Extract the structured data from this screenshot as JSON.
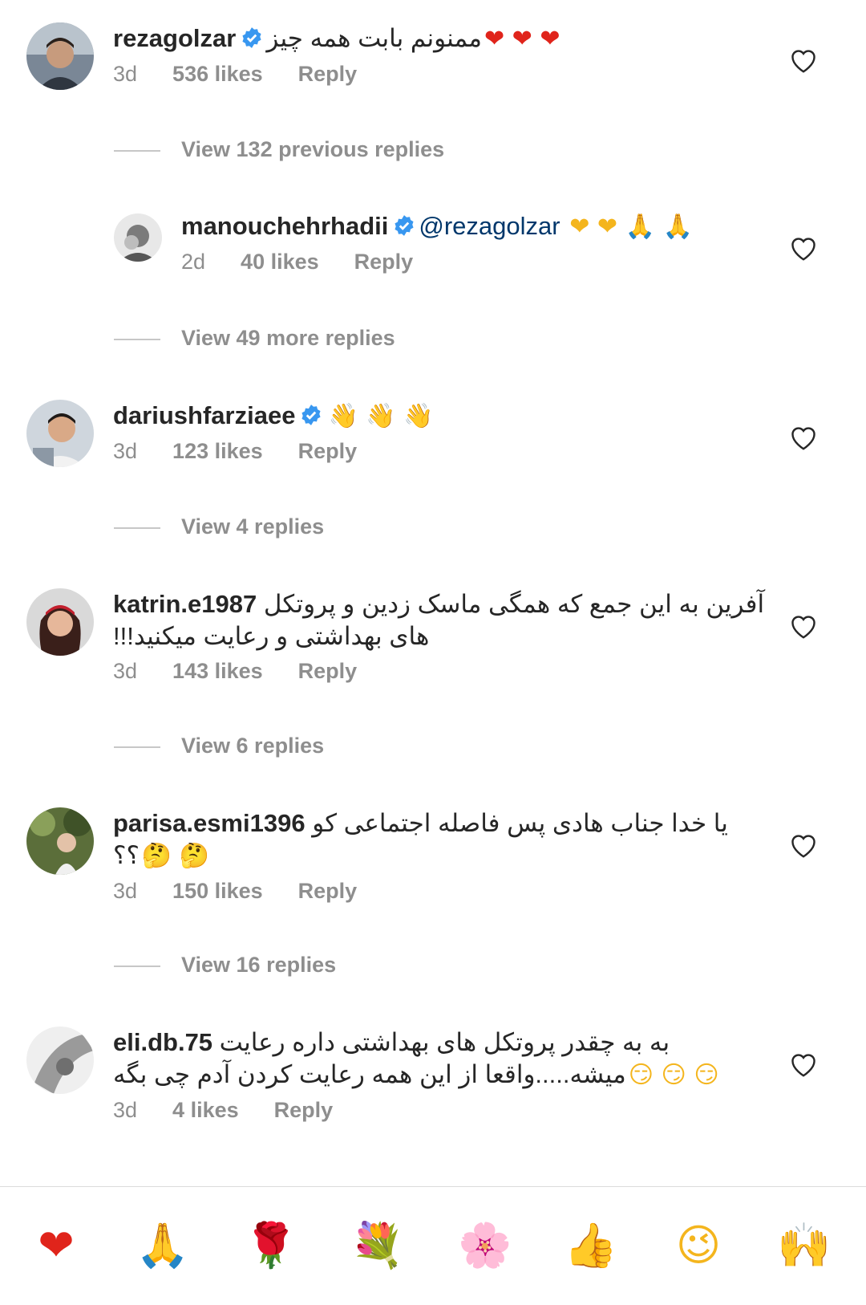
{
  "comments": [
    {
      "username": "rezagolzar",
      "verified": true,
      "text": "ممنونم بابت همه چیز",
      "emojis": "❤ ❤ ❤",
      "time": "3d",
      "likes": "536 likes",
      "reply": "Reply",
      "view_replies": "View 132 previous replies"
    },
    {
      "username": "manouchehrhadii",
      "verified": true,
      "mention": "@rezagolzar",
      "emojis": "❤ ❤ 🙏 🙏",
      "time": "2d",
      "likes": "40 likes",
      "reply": "Reply",
      "view_replies": "View 49 more replies"
    },
    {
      "username": "dariushfarziaee",
      "verified": true,
      "emojis": "👋 👋 👋",
      "time": "3d",
      "likes": "123 likes",
      "reply": "Reply",
      "view_replies": "View 4 replies"
    },
    {
      "username": "katrin.e1987",
      "text_line1": "آفرین به این جمع که همگی ماسک زدین و پروتکل",
      "text_line2": "های بهداشتی و رعایت میکنید!!!",
      "time": "3d",
      "likes": "143 likes",
      "reply": "Reply",
      "view_replies": "View 6 replies"
    },
    {
      "username": "parisa.esmi1396",
      "text_line1": "یا خدا جناب هادی پس فاصله  اجتماعی کو",
      "text_line2": "؟؟",
      "emojis": "🤔 🤔",
      "time": "3d",
      "likes": "150 likes",
      "reply": "Reply",
      "view_replies": "View 16 replies"
    },
    {
      "username": "eli.db.75",
      "text_line1": "به به چقدر پروتکل های بهداشتی داره رعایت",
      "text_line2": "میشه.....واقعا از این همه رعایت کردن آدم چی بگه",
      "emojis": "😏 😏 😏",
      "time": "3d",
      "likes": "4 likes",
      "reply": "Reply"
    }
  ],
  "quick_reactions": [
    {
      "icon": "red-heart",
      "glyph": "❤"
    },
    {
      "icon": "praying-hands",
      "glyph": "🙏"
    },
    {
      "icon": "rose",
      "glyph": "🌹"
    },
    {
      "icon": "bouquet",
      "glyph": "💐"
    },
    {
      "icon": "cherry-blossom",
      "glyph": "🌸"
    },
    {
      "icon": "thumbs-up",
      "glyph": "👍"
    },
    {
      "icon": "winking-face",
      "glyph": "😉"
    },
    {
      "icon": "raising-hands",
      "glyph": "🙌"
    }
  ],
  "colors": {
    "text": "#262626",
    "muted": "#8e8e8e",
    "mention": "#00376b",
    "verified": "#3897f0",
    "heart": "#e0241b"
  }
}
